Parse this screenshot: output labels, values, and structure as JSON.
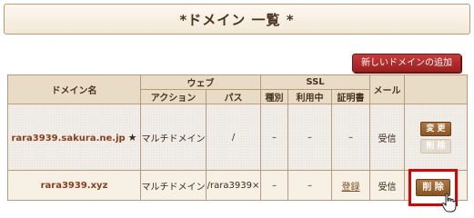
{
  "page_title": "*ドメイン 一覧 *",
  "add_button_label": "新しいドメインの追加",
  "table": {
    "headers": {
      "domain": "ドメイン名",
      "web": "ウェブ",
      "ssl": "SSL",
      "mail": "メール",
      "action": "アクション",
      "path": "パス",
      "type": "種別",
      "in_use": "利用中",
      "cert": "証明書"
    },
    "rows": [
      {
        "domain": "rara3939.sakura.ne.jp",
        "star": "★",
        "action": "マルチドメイン",
        "path": "/",
        "type": "–",
        "in_use": "–",
        "cert": "–",
        "mail": "受信",
        "change": "変 更",
        "delete": "削 除"
      },
      {
        "domain": "rara3939.xyz",
        "action": "マルチドメイン",
        "path": "/rara3939×",
        "type": "–",
        "in_use": "–",
        "cert": "登録",
        "mail": "受信",
        "change": "変 更",
        "delete": "削 除"
      }
    ]
  },
  "colors": {
    "header_bg": "#e9dcc6",
    "border": "#b89a78",
    "add_button": "#b02a2a",
    "action_button": "#9a6030",
    "highlight": "#e00000",
    "domain_text": "#8a3e1e"
  },
  "icons": {
    "cursor": "hand-pointer-icon"
  }
}
